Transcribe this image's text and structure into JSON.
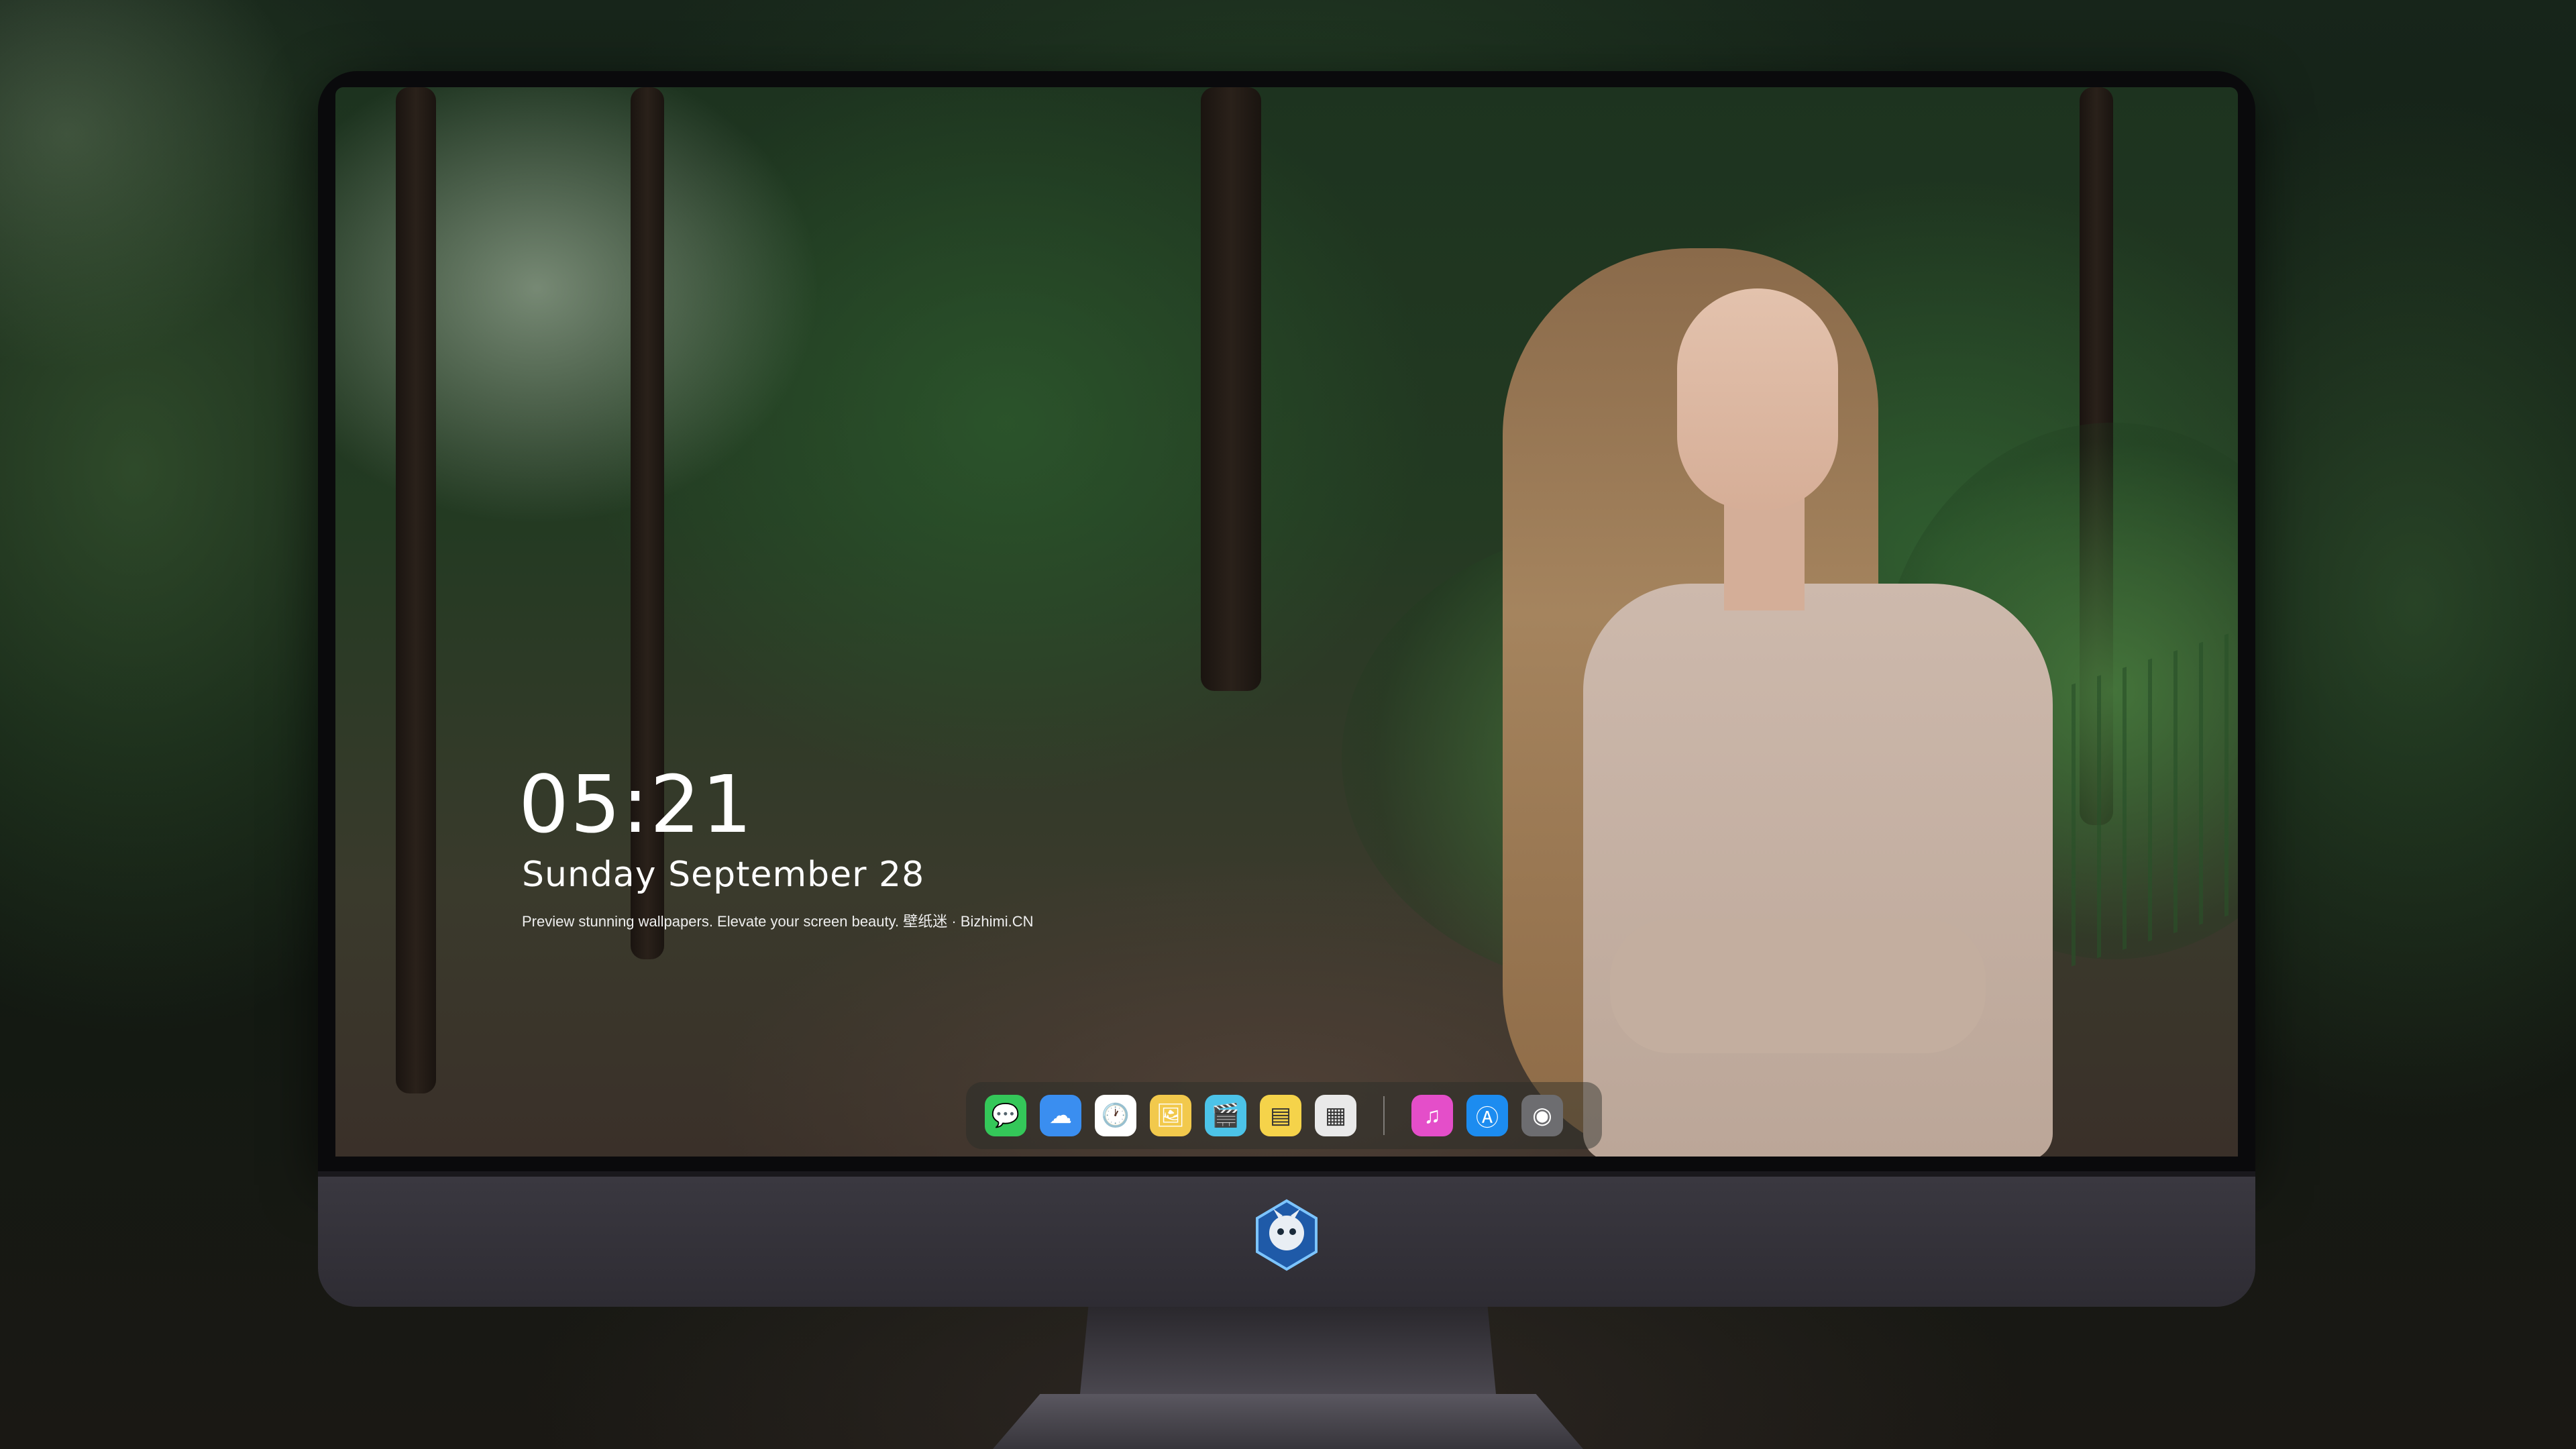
{
  "lockscreen": {
    "time": "05:21",
    "date": "Sunday September  28",
    "caption": "Preview stunning wallpapers. Elevate your screen beauty. 壁纸迷 · Bizhimi.CN"
  },
  "dock": {
    "apps": [
      {
        "name": "messages-icon",
        "glyph": "💬",
        "color": "#34c759"
      },
      {
        "name": "weather-icon",
        "glyph": "☁",
        "color": "#3a8ef0"
      },
      {
        "name": "clock-icon",
        "glyph": "🕐",
        "color": "#ffffff"
      },
      {
        "name": "preview-icon",
        "glyph": "🖼",
        "color": "#f2c94c"
      },
      {
        "name": "clips-icon",
        "glyph": "🎬",
        "color": "#4cc3e8"
      },
      {
        "name": "notes-icon",
        "glyph": "▤",
        "color": "#f5d34a"
      },
      {
        "name": "photos-icon",
        "glyph": "▦",
        "color": "#e9e9e9"
      }
    ],
    "recent_apps": [
      {
        "name": "music-icon",
        "glyph": "♫",
        "color": "#e44ec9"
      },
      {
        "name": "app-store-icon",
        "glyph": "Ⓐ",
        "color": "#1c8cf0"
      },
      {
        "name": "camera-icon",
        "glyph": "◉",
        "color": "#6d6d70"
      }
    ]
  }
}
